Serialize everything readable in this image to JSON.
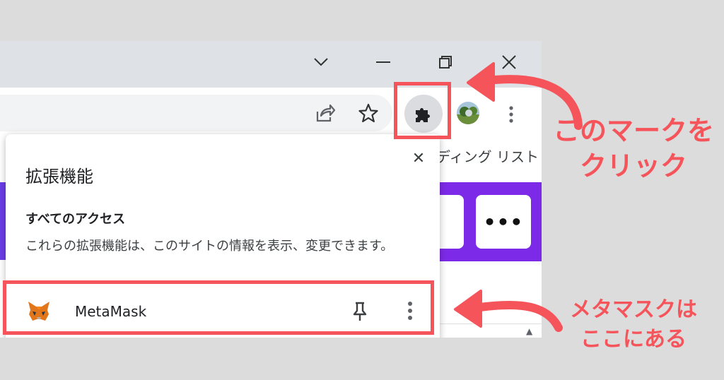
{
  "popup": {
    "title": "拡張機能",
    "close_label": "✕",
    "section_heading": "すべてのアクセス",
    "section_desc": "これらの拡張機能は、このサイトの情報を表示、変更できます。",
    "extension": {
      "name": "MetaMask",
      "icon": "metamask-fox-icon"
    }
  },
  "bookmark_bar": {
    "reading_list": "ディング リスト"
  },
  "page": {
    "more_button": "•••"
  },
  "annotations": {
    "top_note_line1": "このマークを",
    "top_note_line2": "クリック",
    "bottom_note_line1": "メタマスクは",
    "bottom_note_line2": "ここにある"
  },
  "colors": {
    "annotation": "#f5545b",
    "extensions_button_bg": "#dadce0",
    "page_accent": "#7d2ae8"
  },
  "icons": [
    "chevron-down-icon",
    "minimize-icon",
    "restore-icon",
    "close-icon",
    "share-icon",
    "star-icon",
    "puzzle-icon",
    "avatar",
    "menu-icon",
    "pin-icon",
    "more-vert-icon"
  ]
}
